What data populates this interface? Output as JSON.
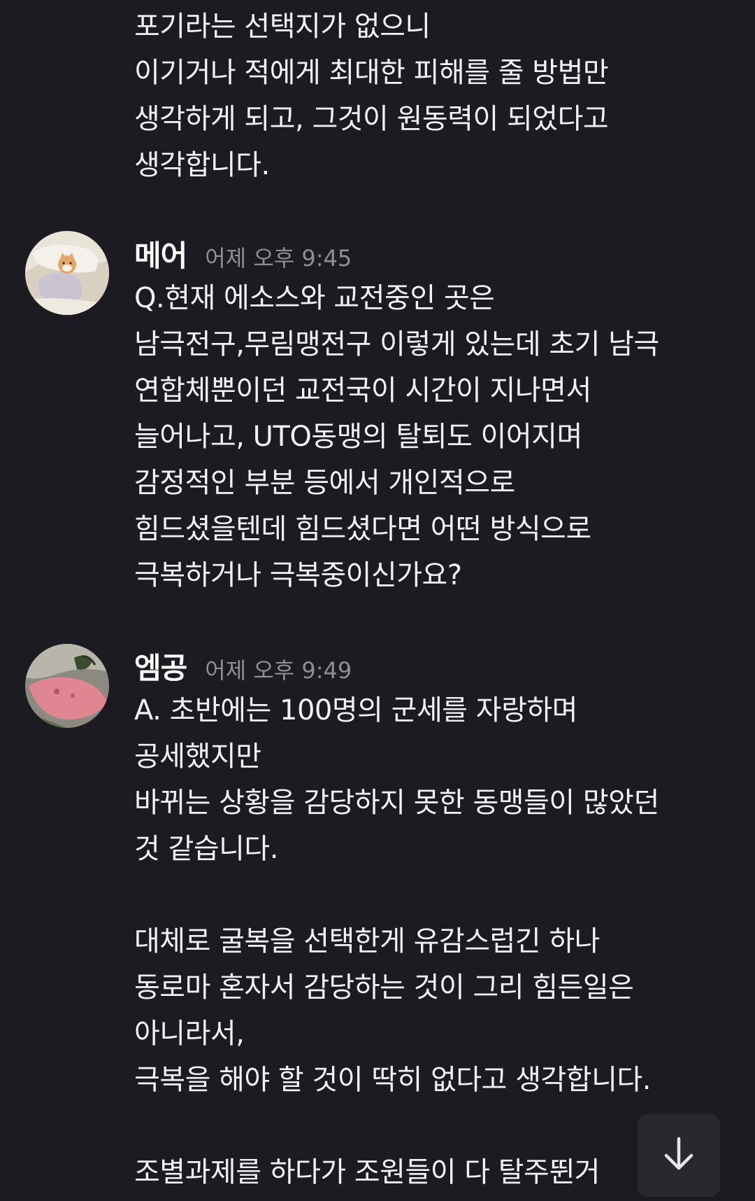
{
  "messages": [
    {
      "partial_top": true,
      "lines": [
        "포기라는 선택지가 없으니",
        "이기거나 적에게 최대한 피해를 줄 방법만",
        "생각하게 되고, 그것이 원동력이 되었다고",
        "생각합니다."
      ]
    },
    {
      "author": "메어",
      "timestamp": "어제 오후 9:45",
      "avatar_icon": "avatar-dog-on-pillow",
      "lines": [
        "Q.현재 에소스와 교전중인 곳은",
        "남극전구,무림맹전구 이렇게 있는데 초기 남극",
        "연합체뿐이던 교전국이 시간이 지나면서",
        "늘어나고, UTO동맹의 탈퇴도 이어지며",
        "감정적인 부분 등에서 개인적으로",
        "힘드셨을텐데 힘드셨다면 어떤 방식으로",
        "극복하거나 극복중이신가요?"
      ]
    },
    {
      "author": "엠공",
      "timestamp": "어제 오후 9:49",
      "avatar_icon": "avatar-pink-character",
      "paragraphs": [
        [
          "A. 초반에는 100명의 군세를 자랑하며",
          "공세했지만",
          "바뀌는 상황을 감당하지 못한 동맹들이 많았던",
          "것 같습니다."
        ],
        [
          "대체로 굴복을 선택한게 유감스럽긴 하나",
          "동로마 혼자서 감당하는 것이 그리 힘든일은",
          "아니라서,",
          "극복을 해야 할 것이 딱히 없다고 생각합니다."
        ],
        [
          "조별과제를 하다가 조원들이 다 탈주뛴거"
        ]
      ]
    }
  ],
  "scroll_button": {
    "icon": "arrow-down-icon"
  },
  "colors": {
    "background": "#1c1b21",
    "text": "#f2f2f4",
    "timestamp": "#8f8e96",
    "button_bg": "#29282f"
  }
}
